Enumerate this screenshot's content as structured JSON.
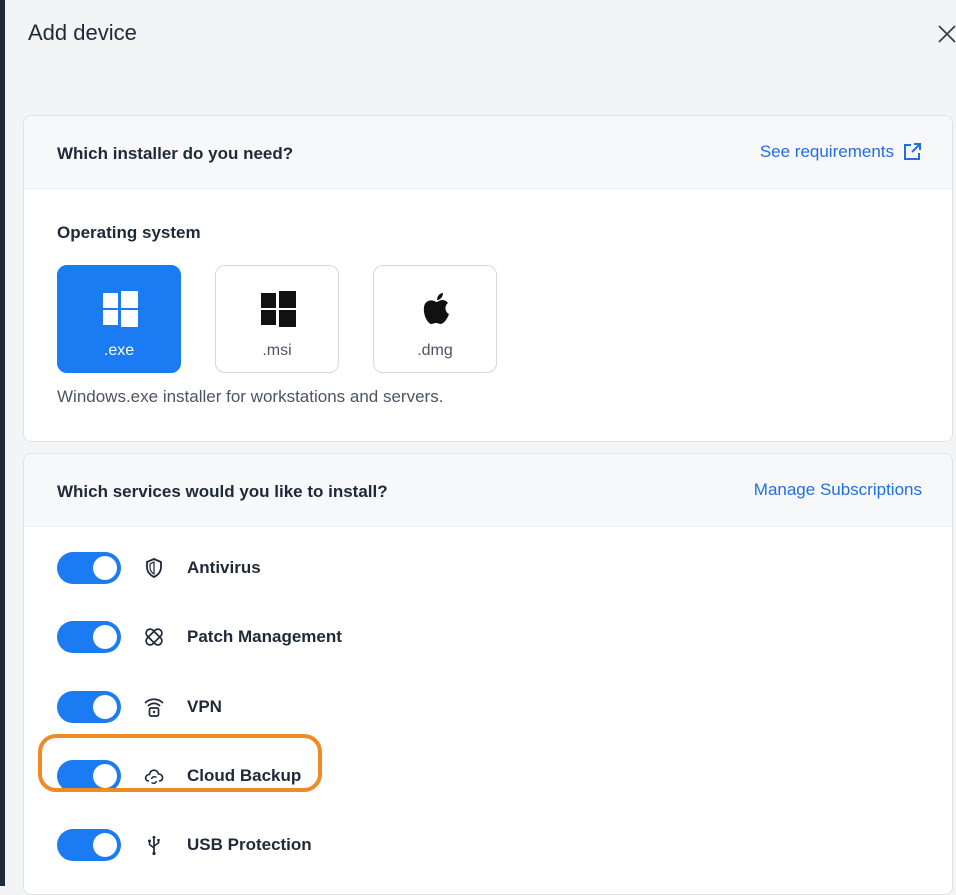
{
  "dialog": {
    "title": "Add device",
    "close_icon": "close-icon"
  },
  "installer_card": {
    "title": "Which installer do you need?",
    "requirements_link": "See requirements",
    "requirements_icon": "external-link-icon",
    "os_label": "Operating system",
    "options": [
      {
        "label": ".exe",
        "icon": "windows-icon",
        "selected": true
      },
      {
        "label": ".msi",
        "icon": "windows-icon",
        "selected": false
      },
      {
        "label": ".dmg",
        "icon": "apple-icon",
        "selected": false
      }
    ],
    "description": "Windows.exe installer for workstations and servers."
  },
  "services_card": {
    "title": "Which services would you like to install?",
    "manage_link": "Manage Subscriptions",
    "services": [
      {
        "label": "Antivirus",
        "icon": "shield-icon",
        "enabled": true
      },
      {
        "label": "Patch Management",
        "icon": "bandage-icon",
        "enabled": true
      },
      {
        "label": "VPN",
        "icon": "wifi-lock-icon",
        "enabled": true
      },
      {
        "label": "Cloud Backup",
        "icon": "cloud-sync-icon",
        "enabled": true,
        "highlighted": true
      },
      {
        "label": "USB Protection",
        "icon": "usb-icon",
        "enabled": true
      }
    ]
  },
  "colors": {
    "accent": "#1a7bf2",
    "highlight": "#f08a24",
    "link": "#1f6fe0"
  }
}
